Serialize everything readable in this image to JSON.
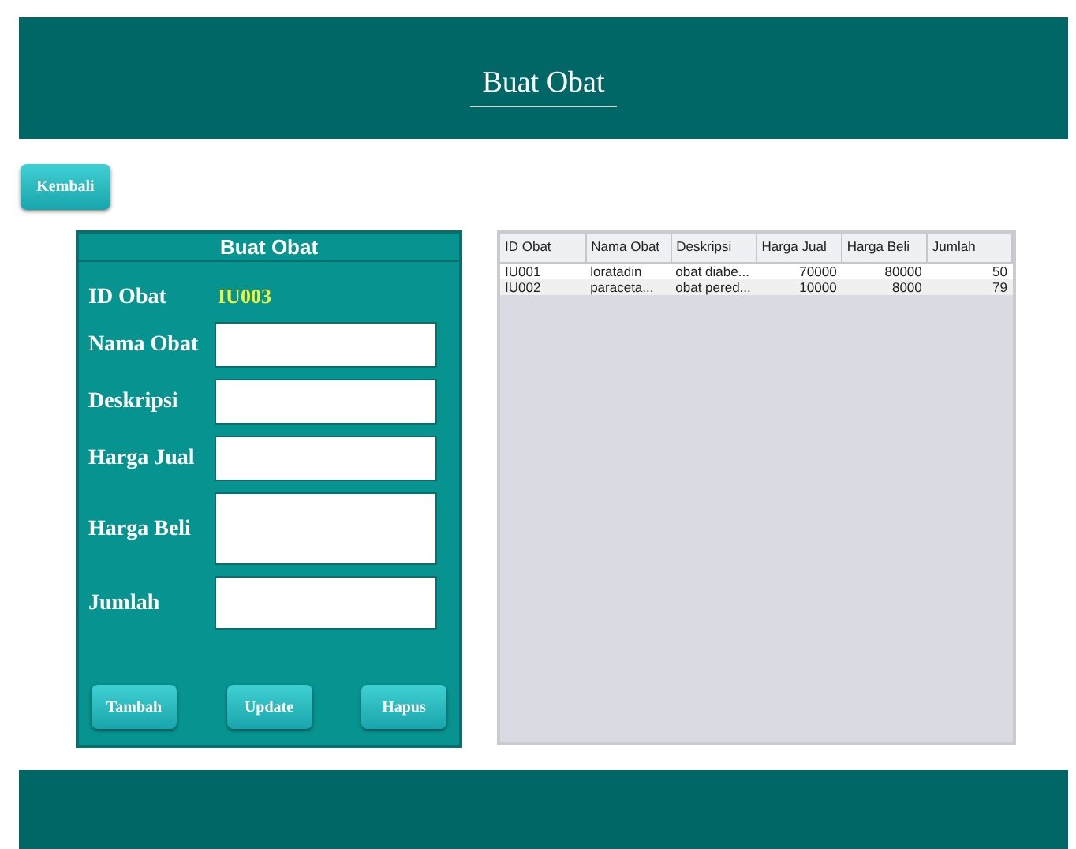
{
  "header": {
    "title": "Buat Obat"
  },
  "back_button": "Kembali",
  "form": {
    "title": "Buat Obat",
    "id_label": "ID Obat",
    "id_value": "IU003",
    "fields": [
      {
        "label": "Nama Obat",
        "kind": "single"
      },
      {
        "label": "Deskripsi",
        "kind": "single"
      },
      {
        "label": "Harga Jual",
        "kind": "single"
      },
      {
        "label": "Harga Beli",
        "kind": "multi"
      },
      {
        "label": "Jumlah",
        "kind": "multi"
      }
    ],
    "buttons": [
      "Tambah",
      "Update",
      "Hapus"
    ]
  },
  "table": {
    "columns": [
      {
        "label": "ID Obat",
        "kind": "text"
      },
      {
        "label": "Nama Obat",
        "kind": "text"
      },
      {
        "label": "Deskripsi",
        "kind": "text"
      },
      {
        "label": "Harga Jual",
        "kind": "number"
      },
      {
        "label": "Harga Beli",
        "kind": "number"
      },
      {
        "label": "Jumlah",
        "kind": "number"
      }
    ],
    "rows": [
      [
        "IU001",
        "loratadin",
        "obat diabe...",
        "70000",
        "80000",
        "50"
      ],
      [
        "IU002",
        "paraceta...",
        "obat pered...",
        "10000",
        "8000",
        "79"
      ]
    ]
  }
}
